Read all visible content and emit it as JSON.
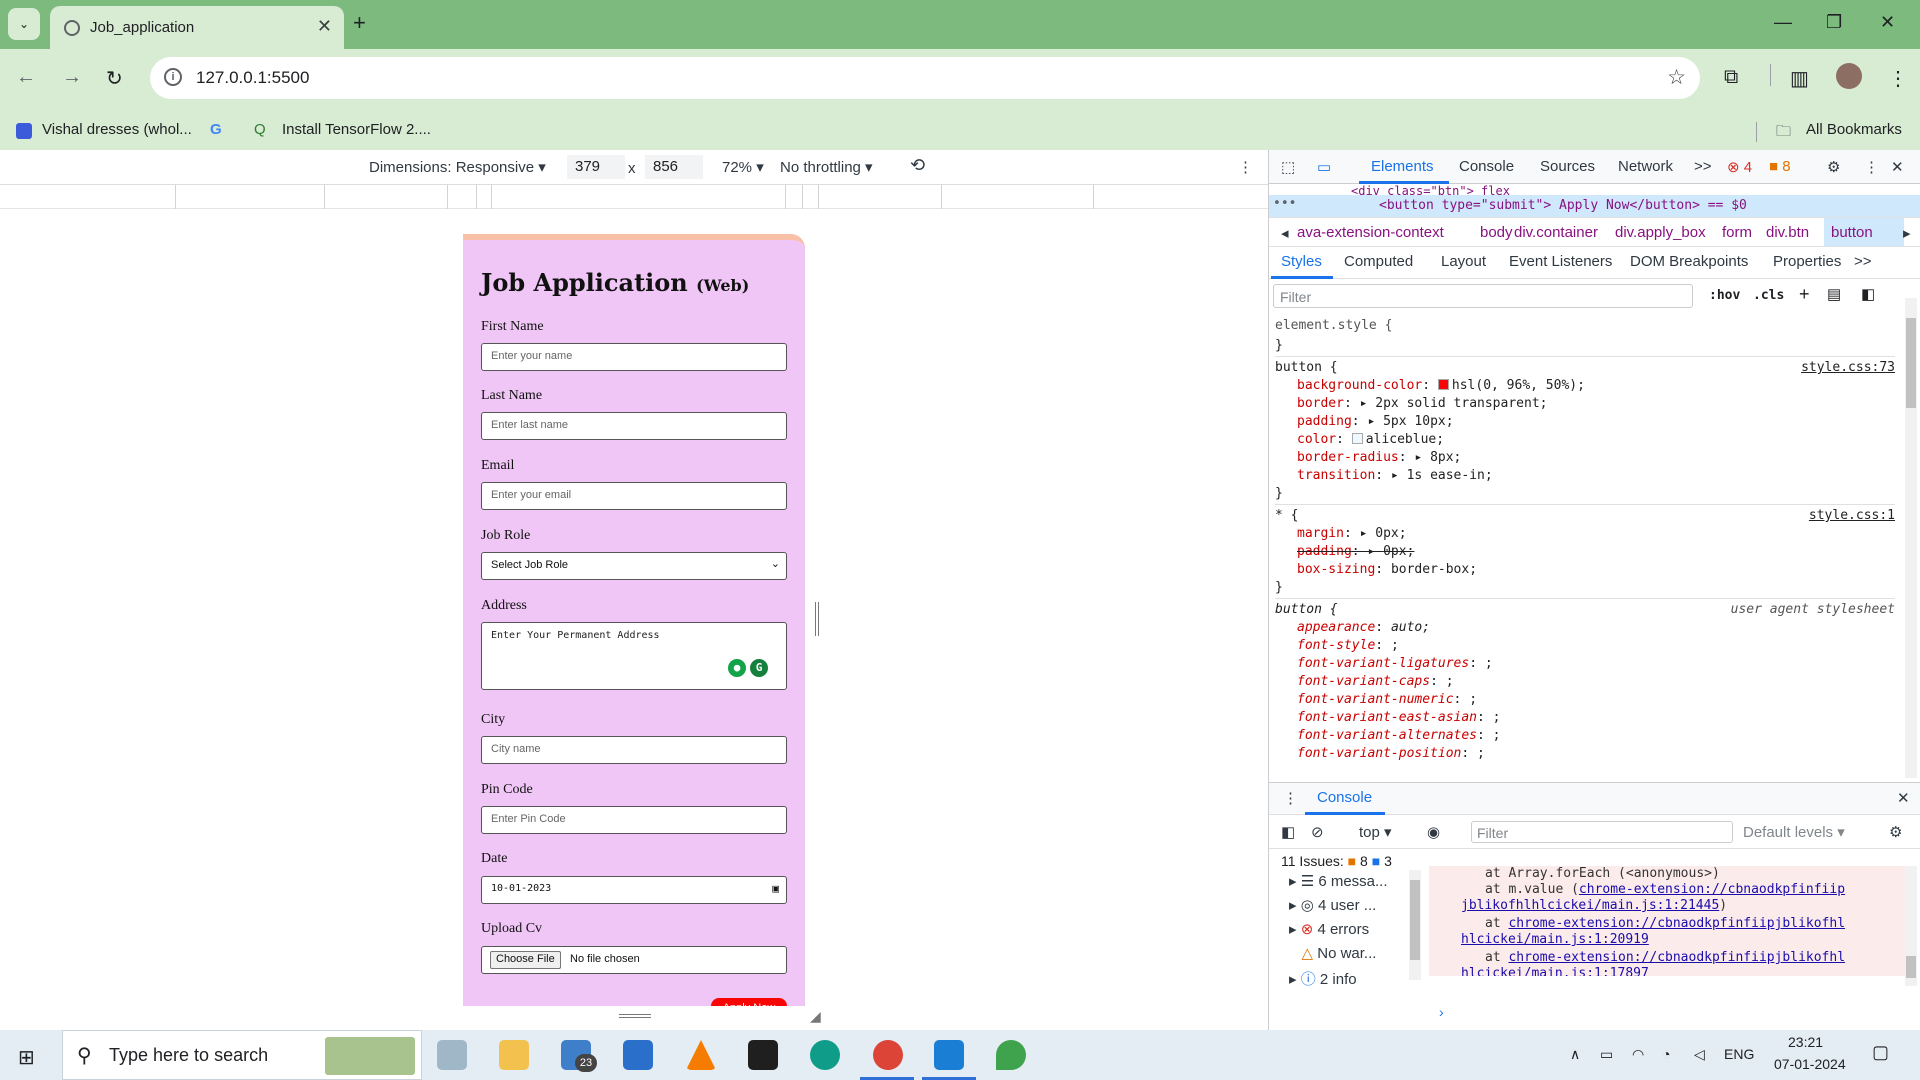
{
  "browser": {
    "tab_title": "Job_application",
    "url": "127.0.0.1:5500",
    "bookmarks": [
      "Vishal dresses (whol...",
      "Install TensorFlow 2....",
      "All Bookmarks"
    ]
  },
  "device_toolbar": {
    "dimensions_label": "Dimensions: Responsive",
    "width": "379",
    "times": "x",
    "height": "856",
    "zoom": "72%",
    "throttle": "No throttling"
  },
  "form": {
    "title": "Job Application",
    "subtitle": "(Web)",
    "fields": [
      {
        "label": "First Name",
        "placeholder": "Enter your name"
      },
      {
        "label": "Last Name",
        "placeholder": "Enter last name"
      },
      {
        "label": "Email",
        "placeholder": "Enter your email"
      },
      {
        "label": "Job Role",
        "placeholder": "Select Job Role"
      },
      {
        "label": "Address",
        "placeholder": "Enter Your Permanent Address"
      },
      {
        "label": "City",
        "placeholder": "City name"
      },
      {
        "label": "Pin Code",
        "placeholder": "Enter Pin Code"
      },
      {
        "label": "Date",
        "placeholder": "10-01-2023"
      },
      {
        "label": "Upload Cv",
        "placeholder": "No file chosen"
      }
    ],
    "choose_file": "Choose File",
    "apply_button": "Apply Now"
  },
  "devtools": {
    "tabs": [
      "Elements",
      "Console",
      "Sources",
      "Network",
      ">>"
    ],
    "errors": "4",
    "warnings": "8",
    "dom_top": "<div class=\"btn\"> flex",
    "dom_selected": "<button type=\"submit\"> Apply Now</button> == $0",
    "breadcrumbs": [
      "ava-extension-context",
      "body",
      "div.container",
      "div.apply_box",
      "form",
      "div.btn",
      "button"
    ],
    "style_tabs": [
      "Styles",
      "Computed",
      "Layout",
      "Event Listeners",
      "DOM Breakpoints",
      "Properties",
      ">>"
    ],
    "filter_placeholder": "Filter",
    "hov": ":hov",
    "cls": ".cls",
    "element_style": "element.style {",
    "close_brace": "}",
    "rule1_selector": "button {",
    "rule1_source": "style.css:73",
    "rule1_props": [
      {
        "p": "background-color",
        "v": "hsl(0, 96%, 50%);"
      },
      {
        "p": "border",
        "v": "2px solid transparent;"
      },
      {
        "p": "padding",
        "v": "5px 10px;"
      },
      {
        "p": "color",
        "v": "aliceblue;"
      },
      {
        "p": "border-radius",
        "v": "8px;"
      },
      {
        "p": "transition",
        "v": "1s ease-in;"
      }
    ],
    "rule2_selector": "* {",
    "rule2_source": "style.css:1",
    "rule2_props": [
      {
        "p": "margin",
        "v": "0px;"
      },
      {
        "p": "padding",
        "v": "0px;"
      },
      {
        "p": "box-sizing",
        "v": "border-box;"
      }
    ],
    "rule3_selector": "button {",
    "rule3_source": "user agent stylesheet",
    "rule3_props": [
      {
        "p": "appearance",
        "v": "auto;"
      },
      {
        "p": "font-style",
        "v": ";"
      },
      {
        "p": "font-variant-ligatures",
        "v": ";"
      },
      {
        "p": "font-variant-caps",
        "v": ";"
      },
      {
        "p": "font-variant-numeric",
        "v": ";"
      },
      {
        "p": "font-variant-east-asian",
        "v": ";"
      },
      {
        "p": "font-variant-alternates",
        "v": ";"
      },
      {
        "p": "font-variant-position",
        "v": ";"
      }
    ],
    "console_title": "Console",
    "console_context": "top",
    "console_filter": "Filter",
    "default_levels": "Default levels",
    "issues": "11 Issues:",
    "issue_warn": "8",
    "issue_info": "3",
    "side_items": [
      "6 messa...",
      "4 user ...",
      "4 errors",
      "No war...",
      "2 info"
    ],
    "error_lines": [
      "at Array.forEach (<anonymous>)",
      "at m.value (",
      "chrome-extension://cbnaodkpfinfiip",
      "jblikofhlhlcickei/main.js:1:21445",
      ")",
      "at ",
      "chrome-extension://cbnaodkpfinfiipjblikofhl",
      "hlcickei/main.js:1:20919",
      "chrome-extension://cbnaodkpfinfiipjblikofhl",
      "hlcickei/main.js:1:17897"
    ]
  },
  "taskbar": {
    "search_placeholder": "Type here to search",
    "mail_badge": "23",
    "lang": "ENG",
    "time": "23:21",
    "date": "07-01-2024"
  }
}
